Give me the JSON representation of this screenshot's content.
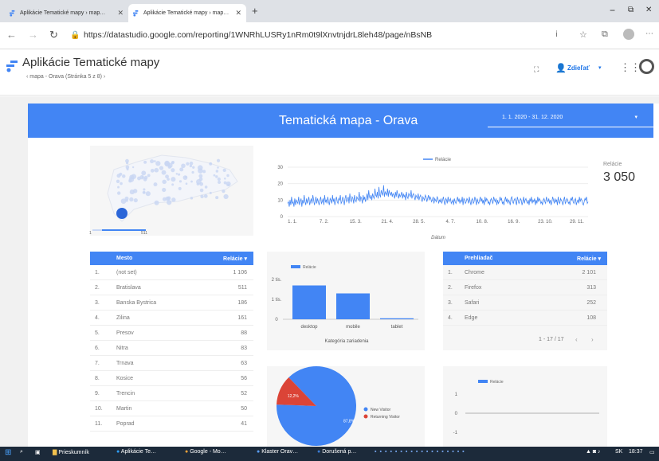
{
  "browser": {
    "tabs": [
      {
        "label": "Aplikácie Tematické mapy › map…",
        "close": "✕"
      },
      {
        "label": "Aplikácie Tematické mapy › map…",
        "close": "✕"
      }
    ],
    "new_tab": "+",
    "url": "https://datastudio.google.com/reporting/1WNRhLUSRy1nRm0t9lXnvtnjdrL8leh48/page/nBsNB",
    "window": {
      "minimize": "−",
      "restore": "⧉",
      "close": "✕"
    }
  },
  "app": {
    "title": "Aplikácie Tematické mapy",
    "breadcrumb": "mapa - Orava (Stránka 5 z 8)",
    "share_label": "Zdieľať",
    "brand_color": "#4285f4"
  },
  "report": {
    "title": "Tematická mapa - Orava",
    "date_range": "1. 1. 2020 - 31. 12. 2020",
    "map_legend_max": "511",
    "map_legend_min": "1",
    "scorecard": {
      "label": "Relácie",
      "value": "3 050"
    },
    "city_table": {
      "headers": [
        "Mesto",
        "Relácie ▾"
      ],
      "rows": [
        [
          "1.",
          "(not set)",
          "1 106"
        ],
        [
          "2.",
          "Bratislava",
          "511"
        ],
        [
          "3.",
          "Banska Bystrica",
          "186"
        ],
        [
          "4.",
          "Zilina",
          "161"
        ],
        [
          "5.",
          "Presov",
          "88"
        ],
        [
          "6.",
          "Nitra",
          "83"
        ],
        [
          "7.",
          "Trnava",
          "63"
        ],
        [
          "8.",
          "Kosice",
          "56"
        ],
        [
          "9.",
          "Trencin",
          "52"
        ],
        [
          "10.",
          "Martin",
          "50"
        ],
        [
          "11.",
          "Poprad",
          "41"
        ]
      ]
    },
    "browser_table": {
      "headers": [
        "Prehliadač",
        "Relácie ▾"
      ],
      "rows": [
        [
          "1.",
          "Chrome",
          "2 101"
        ],
        [
          "2.",
          "Firefox",
          "313"
        ],
        [
          "3.",
          "Safari",
          "252"
        ],
        [
          "4.",
          "Edge",
          "108"
        ]
      ],
      "pagination": "1 - 17 / 17"
    }
  },
  "chart_data": [
    {
      "type": "line",
      "legend": "Relácie",
      "xlabel": "Dátum",
      "x_ticks": [
        "1. 1.",
        "7. 2.",
        "15. 3.",
        "21. 4.",
        "28. 5.",
        "4. 7.",
        "10. 8.",
        "16. 9.",
        "23. 10.",
        "29. 11."
      ],
      "y_ticks": [
        "0",
        "10",
        "20",
        "30"
      ],
      "ylim": [
        0,
        30
      ],
      "values": [
        8,
        9,
        6,
        10,
        7,
        12,
        8,
        9,
        6,
        11,
        7,
        10,
        9,
        8,
        12,
        7,
        9,
        11,
        6,
        10,
        8,
        13,
        9,
        7,
        11,
        8,
        10,
        12,
        7,
        9,
        11,
        8,
        13,
        10,
        7,
        9,
        12,
        8,
        11,
        9,
        7,
        10,
        12,
        8,
        9,
        11,
        7,
        13,
        9,
        10,
        8,
        12,
        9,
        7,
        11,
        10,
        8,
        13,
        9,
        11,
        7,
        10,
        12,
        9,
        8,
        11,
        10,
        13,
        8,
        9,
        12,
        10,
        7,
        11,
        13,
        9,
        10,
        12,
        8,
        14,
        10,
        9,
        12,
        11,
        8,
        13,
        10,
        9,
        12,
        11,
        10,
        15,
        9,
        12,
        11,
        8,
        13,
        10,
        12,
        9,
        11,
        14,
        10,
        16,
        12,
        11,
        13,
        10,
        14,
        12,
        11,
        17,
        13,
        12,
        15,
        11,
        18,
        13,
        12,
        16,
        14,
        13,
        19,
        12,
        15,
        14,
        13,
        17,
        12,
        16,
        14,
        13,
        15,
        12,
        14,
        13,
        11,
        15,
        12,
        16,
        13,
        11,
        14,
        12,
        13,
        15,
        11,
        14,
        12,
        13,
        10,
        15,
        12,
        11,
        14,
        13,
        12,
        16,
        11,
        13,
        14,
        12,
        10,
        13,
        12,
        11,
        14,
        10,
        12,
        13,
        11,
        9,
        12,
        11,
        10,
        13,
        12,
        9,
        11,
        13,
        10,
        12,
        11,
        9,
        10,
        12,
        8,
        11,
        10,
        9,
        12,
        11,
        8,
        10,
        9,
        11,
        8,
        10,
        12,
        9,
        7,
        11,
        10,
        8,
        12,
        9,
        10,
        11,
        8,
        9,
        10,
        7,
        11,
        9,
        8,
        10,
        12,
        9,
        11,
        8,
        10,
        9,
        12,
        7,
        11,
        10,
        8,
        9,
        11,
        10,
        8,
        12,
        9,
        7,
        10,
        11,
        8,
        9,
        12,
        10,
        7,
        11,
        9,
        8,
        10,
        12,
        9,
        11,
        8,
        10,
        7,
        12,
        9,
        11,
        10,
        8,
        9,
        7,
        10,
        11,
        9,
        8,
        12,
        10,
        9,
        11,
        7,
        10,
        8,
        9,
        12,
        10,
        11,
        8,
        9,
        7,
        10,
        12,
        9,
        11,
        8,
        10,
        9,
        7,
        11,
        12,
        9,
        8,
        10,
        11,
        9,
        7,
        12,
        10,
        8,
        9,
        11,
        10,
        7,
        9,
        12,
        8,
        10,
        11,
        9,
        8,
        10,
        7,
        11,
        9,
        12,
        8,
        10,
        9,
        11,
        7,
        10,
        8,
        12,
        9,
        11,
        10,
        8,
        9,
        7,
        10,
        11,
        9,
        8,
        12,
        10,
        9,
        11,
        8,
        10,
        7,
        9,
        12,
        10,
        8,
        11,
        9,
        10,
        7,
        12,
        9,
        8,
        11,
        10,
        9,
        7,
        10,
        12,
        8,
        9,
        11,
        10,
        8,
        9,
        7,
        11,
        10,
        12,
        9,
        8,
        10,
        11,
        7,
        9,
        10,
        8,
        12,
        9,
        11,
        10,
        8,
        7,
        9,
        11,
        10,
        12,
        8,
        9
      ]
    },
    {
      "type": "bar",
      "legend": "Relácie",
      "categories": [
        "desktop",
        "mobile",
        "tablet"
      ],
      "values": [
        1700,
        1300,
        50
      ],
      "y_ticks": [
        "0",
        "1 tis.",
        "2 tis."
      ],
      "ylim": [
        0,
        2400
      ],
      "xlabel": "Kategória zariadenia",
      "color": "#4285f4"
    },
    {
      "type": "pie",
      "slices": [
        {
          "name": "New Visitor",
          "value": 87.8,
          "label": "87,8%",
          "color": "#4285f4"
        },
        {
          "name": "Returning Visitor",
          "value": 12.2,
          "label": "12,2%",
          "color": "#db4437"
        }
      ]
    },
    {
      "type": "line",
      "legend": "Relácie",
      "y_ticks": [
        "1",
        "0",
        "-1"
      ],
      "ylim": [
        -1,
        1
      ],
      "values": [
        0,
        0
      ]
    }
  ],
  "taskbar": {
    "search": "Prieskumník",
    "items": [
      "Aplikácie Te…",
      "Google - Mo…",
      "Klaster Orav…",
      "Dorušená p…"
    ],
    "lang": "SK",
    "time": "18:37"
  }
}
